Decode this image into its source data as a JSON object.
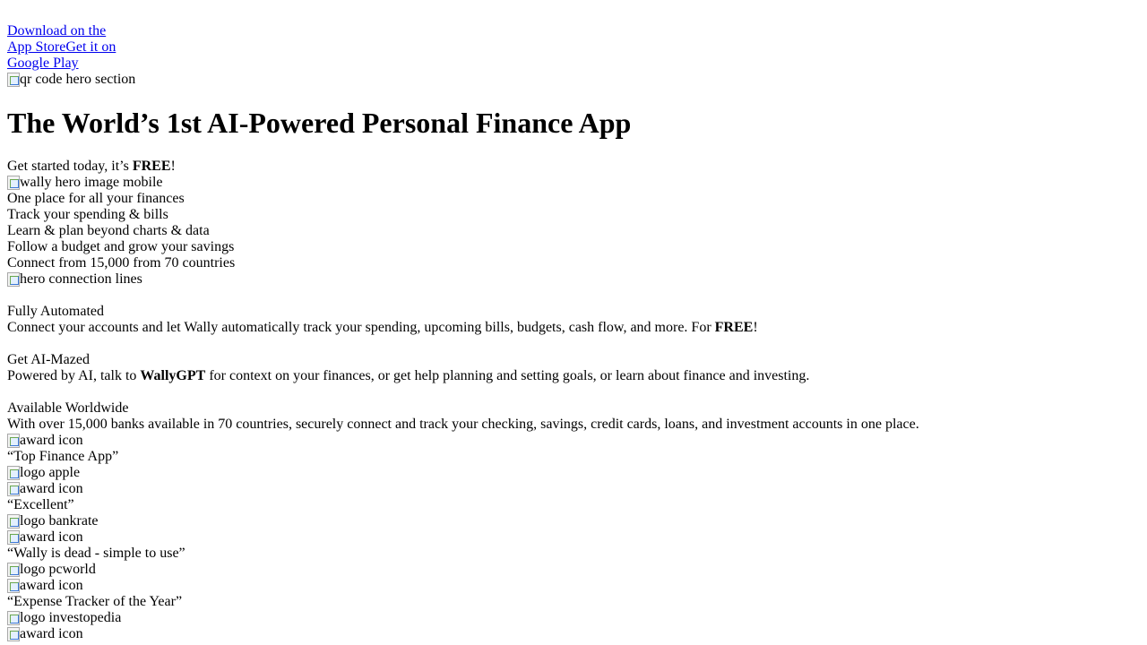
{
  "hero": {
    "app_store_line1": "Download on the",
    "app_store_line2": "App Store",
    "google_play_line1": "Get it on",
    "google_play_line2": "Google Play",
    "qr_alt": "qr code hero section",
    "title": "The World’s 1st AI-Powered Personal Finance App",
    "cta_prefix": "Get started today, it’s ",
    "cta_bold": "FREE",
    "cta_suffix": "!",
    "hero_image_alt": "wally hero image mobile",
    "bullets": [
      "One place for all your finances",
      "Track your spending & bills",
      "Learn & plan beyond charts & data",
      "Follow a budget and grow your savings",
      "Connect from 15,000 from 70 countries"
    ],
    "connection_lines_alt": "hero connection lines"
  },
  "features": [
    {
      "title": "Fully Automated",
      "desc_prefix": "Connect your accounts and let Wally automatically track your spending, upcoming bills, budgets, cash flow, and more. For ",
      "desc_bold": "FREE",
      "desc_suffix": "!"
    },
    {
      "title": "Get AI-Mazed",
      "desc_prefix": "Powered by AI, talk to ",
      "desc_bold": "WallyGPT",
      "desc_suffix": " for context on your finances, or get help planning and setting goals, or learn about finance and investing."
    },
    {
      "title": "Available Worldwide",
      "desc_prefix": "With over 15,000 banks available in 70 countries, securely connect and track your checking, savings, credit cards, loans, and investment accounts in one place.",
      "desc_bold": "",
      "desc_suffix": ""
    }
  ],
  "awards": [
    {
      "icon_alt": "award icon",
      "quote": "“Top Finance App”",
      "logo_alt": "logo apple"
    },
    {
      "icon_alt": "award icon",
      "quote": "“Excellent”",
      "logo_alt": "logo bankrate"
    },
    {
      "icon_alt": "award icon",
      "quote": "“Wally is dead - simple to use”",
      "logo_alt": "logo pcworld"
    },
    {
      "icon_alt": "award icon",
      "quote": "“Expense Tracker of the Year”",
      "logo_alt": "logo investopedia"
    },
    {
      "icon_alt": "award icon"
    }
  ],
  "colors": {
    "link": "#0000ee",
    "text": "#000000",
    "background": "#ffffff"
  }
}
